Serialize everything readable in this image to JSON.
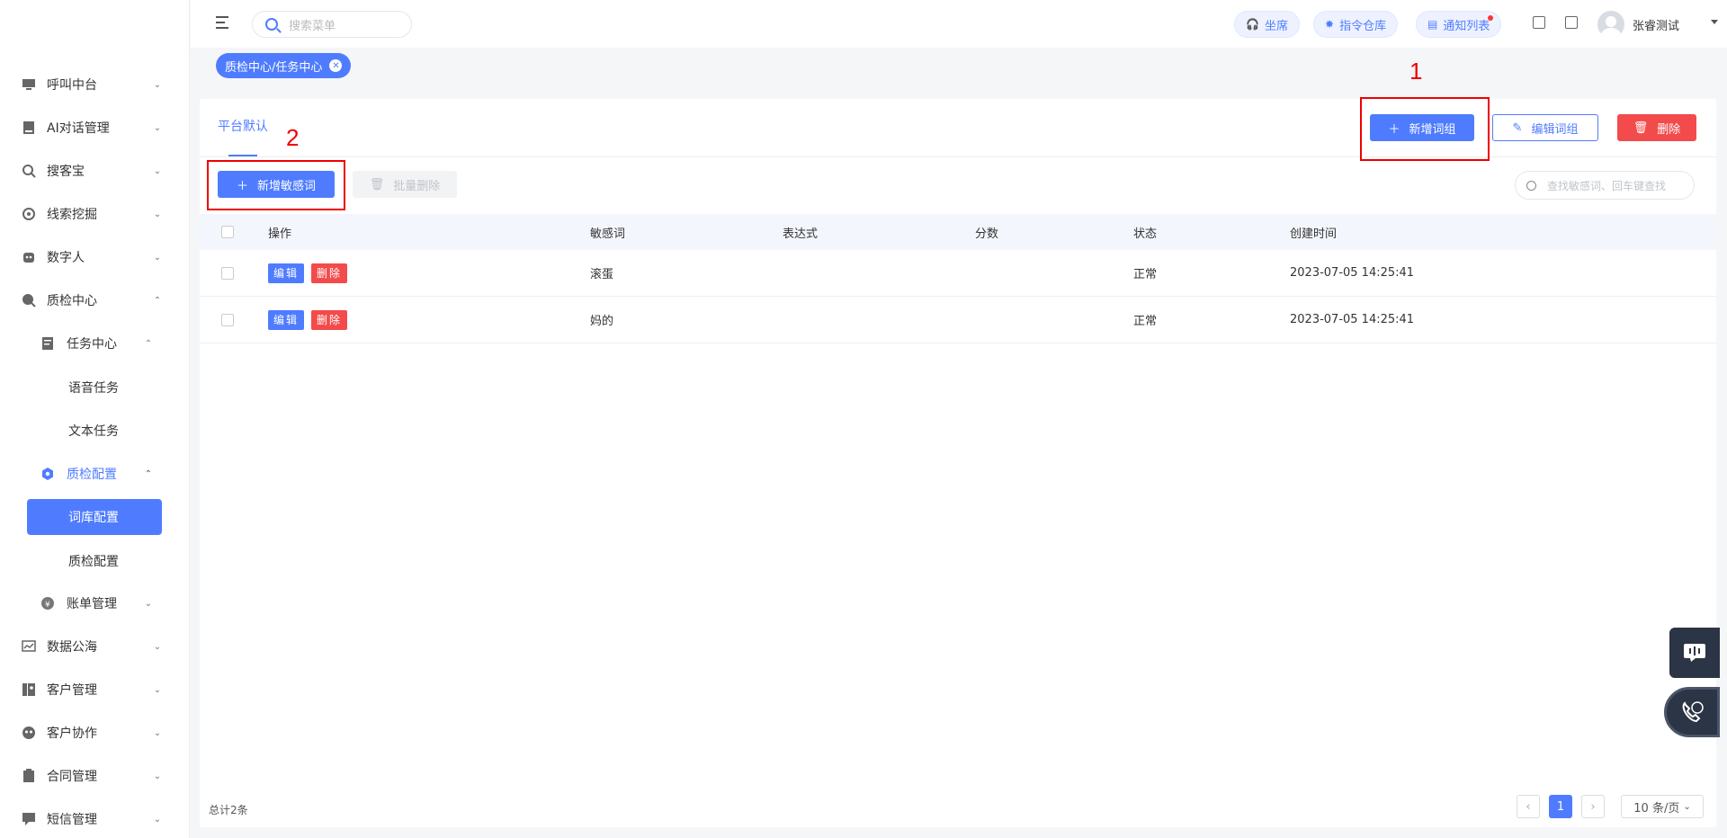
{
  "sidebar": {
    "items": [
      {
        "label": "呼叫中台",
        "icon": "monitor-icon"
      },
      {
        "label": "AI对话管理",
        "icon": "book-icon"
      },
      {
        "label": "搜客宝",
        "icon": "search-icon"
      },
      {
        "label": "线索挖掘",
        "icon": "target-icon"
      },
      {
        "label": "数字人",
        "icon": "robot-icon"
      },
      {
        "label": "质检中心",
        "icon": "inspect-icon"
      },
      {
        "label": "任务中心",
        "icon": "task-icon"
      },
      {
        "label": "语音任务"
      },
      {
        "label": "文本任务"
      },
      {
        "label": "质检配置",
        "icon": "hexagon-icon"
      },
      {
        "label": "词库配置"
      },
      {
        "label": "质检配置"
      },
      {
        "label": "账单管理",
        "icon": "bill-icon"
      },
      {
        "label": "数据公海",
        "icon": "chart-icon"
      },
      {
        "label": "客户管理",
        "icon": "contacts-icon"
      },
      {
        "label": "客户协作",
        "icon": "collab-icon"
      },
      {
        "label": "合同管理",
        "icon": "contract-icon"
      },
      {
        "label": "短信管理",
        "icon": "message-icon"
      }
    ]
  },
  "header": {
    "search_placeholder": "搜索菜单",
    "btn_seat": "坐席",
    "btn_command": "指令仓库",
    "btn_notice": "通知列表",
    "username": "张睿测试"
  },
  "tagbar": {
    "active_tag": "质检中心/任务中心"
  },
  "main": {
    "tab": "平台默认",
    "btn_add_group": "新增词组",
    "btn_edit_group": "编辑词组",
    "btn_delete": "删除",
    "btn_add_word": "新增敏感词",
    "btn_batch_delete": "批量删除",
    "search_placeholder": "查找敏感词、回车键查找",
    "annotation_1": "1",
    "annotation_2": "2",
    "table": {
      "headers": [
        "操作",
        "敏感词",
        "表达式",
        "分数",
        "状态",
        "创建时间"
      ],
      "edit_label": "编辑",
      "delete_label": "删除",
      "rows": [
        {
          "word": "滚蛋",
          "expr": "",
          "score": "",
          "status": "正常",
          "created": "2023-07-05 14:25:41"
        },
        {
          "word": "妈的",
          "expr": "",
          "score": "",
          "status": "正常",
          "created": "2023-07-05 14:25:41"
        }
      ]
    },
    "total": "总计2条",
    "page_current": "1",
    "page_size": "10 条/页"
  },
  "colors": {
    "primary": "#4f7cff",
    "danger": "#f34b4b",
    "annotation": "#ee0000"
  }
}
